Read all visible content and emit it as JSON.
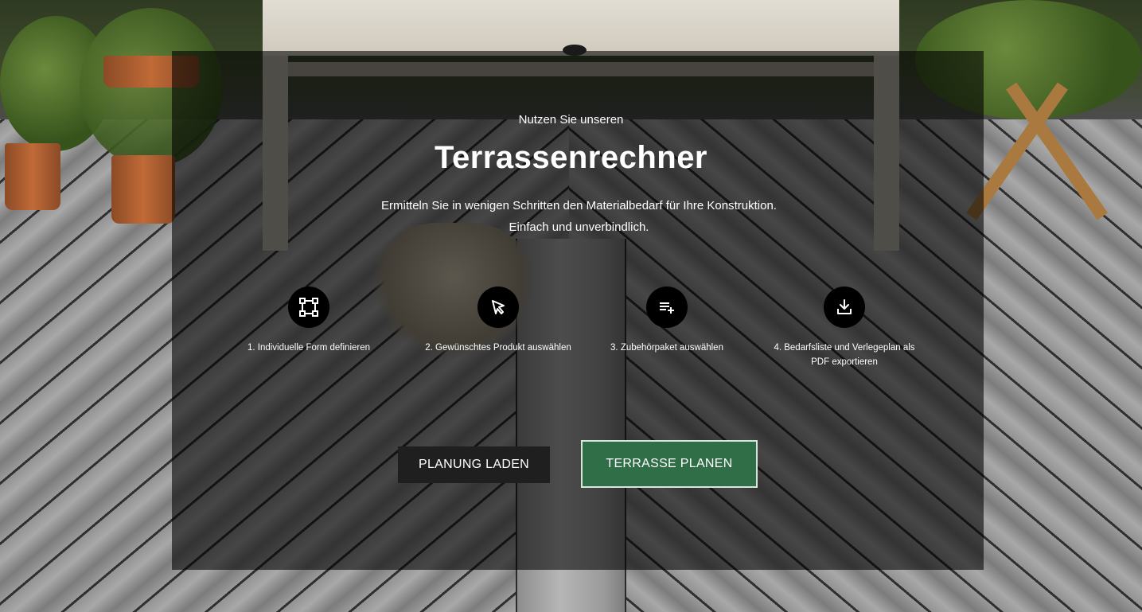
{
  "hero": {
    "intro": "Nutzen Sie unseren",
    "title": "Terrassenrechner",
    "subtitle": "Ermitteln Sie in wenigen Schritten den Materialbedarf für Ihre Konstruktion. Einfach und unverbindlich."
  },
  "steps": [
    {
      "icon": "shape-select-icon",
      "label": "1. Individuelle Form definieren"
    },
    {
      "icon": "cursor-pointer-icon",
      "label": "2. Gewünschtes Produkt auswählen"
    },
    {
      "icon": "playlist-add-icon",
      "label": "3. Zubehörpaket auswählen"
    },
    {
      "icon": "download-icon",
      "label": "4. Bedarfsliste und Verlegeplan als PDF exportieren"
    }
  ],
  "buttons": {
    "load": "PLANUNG LADEN",
    "plan": "TERRASSE PLANEN"
  },
  "colors": {
    "accent_green": "#2f6e46",
    "overlay": "rgba(0,0,0,0.58)",
    "dark_button": "#1f1f1f"
  }
}
